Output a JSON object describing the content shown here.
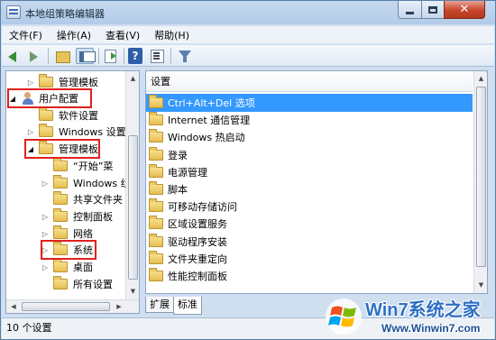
{
  "window": {
    "title": "本地组策略编辑器",
    "caption_close": "✕"
  },
  "menu": {
    "items": [
      {
        "label": "文件(F)"
      },
      {
        "label": "操作(A)"
      },
      {
        "label": "查看(V)"
      },
      {
        "label": "帮助(H)"
      }
    ]
  },
  "toolbar": {
    "help_label": "?"
  },
  "tree": {
    "items": [
      {
        "label": "管理模板",
        "expander": "▷",
        "icon": "folder-icon"
      },
      {
        "label": "用户配置",
        "expander": "◢",
        "icon": "user-config-icon"
      },
      {
        "label": "软件设置",
        "expander": "",
        "icon": "folder-icon"
      },
      {
        "label": "Windows 设置",
        "expander": "▷",
        "icon": "folder-icon"
      },
      {
        "label": "管理模板",
        "expander": "◢",
        "icon": "folder-icon"
      },
      {
        "label": "“开始”菜",
        "expander": "",
        "icon": "folder-icon"
      },
      {
        "label": "Windows 组",
        "expander": "▷",
        "icon": "folder-icon"
      },
      {
        "label": "共享文件夹",
        "expander": "",
        "icon": "folder-icon"
      },
      {
        "label": "控制面板",
        "expander": "▷",
        "icon": "folder-icon"
      },
      {
        "label": "网络",
        "expander": "▷",
        "icon": "folder-icon"
      },
      {
        "label": "系统",
        "expander": "▷",
        "icon": "folder-icon"
      },
      {
        "label": "桌面",
        "expander": "▷",
        "icon": "folder-icon"
      },
      {
        "label": "所有设置",
        "expander": "",
        "icon": "settings-icon"
      }
    ]
  },
  "list": {
    "column_header": "设置",
    "items": [
      {
        "label": "Ctrl+Alt+Del 选项",
        "selected": true
      },
      {
        "label": "Internet 通信管理",
        "selected": false
      },
      {
        "label": "Windows 热启动",
        "selected": false
      },
      {
        "label": "登录",
        "selected": false
      },
      {
        "label": "电源管理",
        "selected": false
      },
      {
        "label": "脚本",
        "selected": false
      },
      {
        "label": "可移动存储访问",
        "selected": false
      },
      {
        "label": "区域设置服务",
        "selected": false
      },
      {
        "label": "驱动程序安装",
        "selected": false
      },
      {
        "label": "文件夹重定向",
        "selected": false
      },
      {
        "label": "性能控制面板",
        "selected": false
      }
    ]
  },
  "tabs": [
    {
      "label": "扩展",
      "active": false
    },
    {
      "label": "标准",
      "active": true
    }
  ],
  "status": {
    "text": "10 个设置"
  },
  "watermark": {
    "title": "Win7系统之家",
    "url": "Www.Winwin7.com"
  },
  "colors": {
    "selection": "#3399ff",
    "highlight_box": "#e1201e",
    "folder": "#e6be50"
  }
}
